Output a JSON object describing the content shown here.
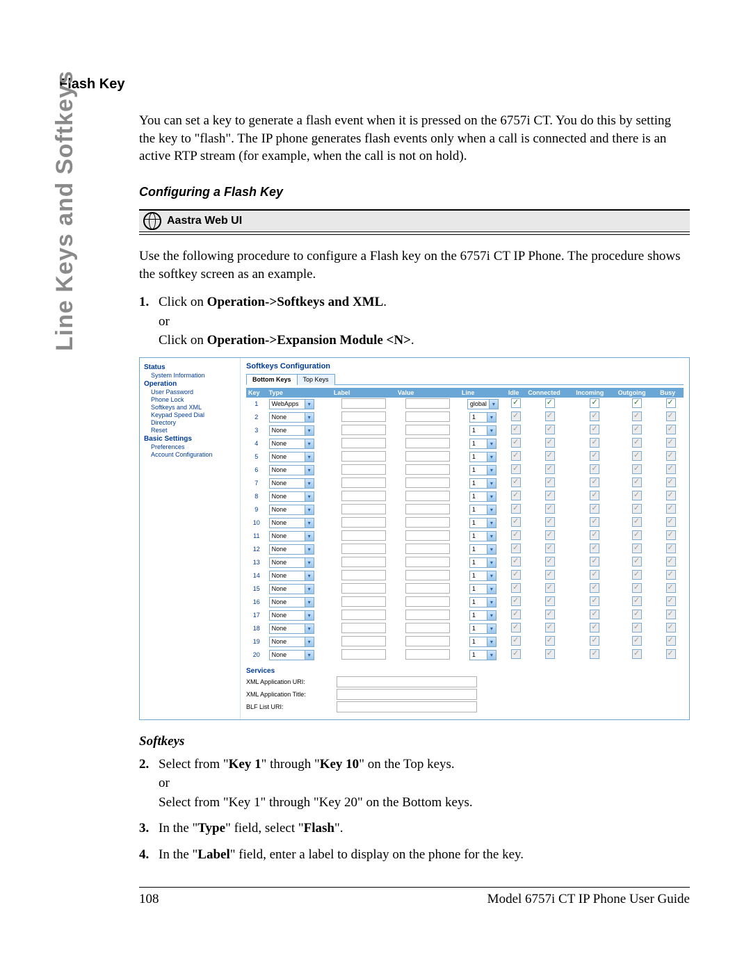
{
  "sidetab": "Line Keys and Softkeys",
  "heading": "Flash Key",
  "intro": "You can set a key to generate a flash event when it is pressed on the 6757i CT. You do this by setting the key to \"flash\". The IP phone generates flash events only when a call is connected and there is an active RTP stream (for example, when the call is not on hold).",
  "sub1": "Configuring a Flash Key",
  "banner": "Aastra Web UI",
  "para2": "Use the following procedure to configure a Flash key on the 6757i CT IP Phone. The procedure shows the softkey screen as an example.",
  "step1": {
    "pre": "Click on ",
    "b1": "Operation->Softkeys and XML",
    "post1": ".",
    "or": "or",
    "pre2": "Click on ",
    "b2": "Operation->Expansion Module <N>",
    "post2": "."
  },
  "softkeys_h": "Softkeys",
  "step2": {
    "a": "Select from \"",
    "b1": "Key 1",
    "mid": "\" through \"",
    "b2": "Key 10",
    "c": "\" on the Top keys.",
    "or": "or",
    "d": "Select from \"Key 1\" through \"Key 20\" on the Bottom keys."
  },
  "step3": {
    "a": "In the \"",
    "b1": "Type",
    "mid": "\" field, select \"",
    "b2": "Flash",
    "c": "\"."
  },
  "step4": {
    "a": "In the \"",
    "b1": "Label",
    "c": "\" field, enter a label to display on the phone for the key."
  },
  "footer": {
    "page": "108",
    "guide": "Model 6757i CT IP Phone User Guide"
  },
  "ui": {
    "title": "Softkeys Configuration",
    "tabs": {
      "bottom": "Bottom Keys",
      "top": "Top Keys"
    },
    "nav": {
      "status": "Status",
      "sysinfo": "System Information",
      "operation": "Operation",
      "userpw": "User Password",
      "phonelock": "Phone Lock",
      "softxml": "Softkeys and XML",
      "keypad": "Keypad Speed Dial",
      "directory": "Directory",
      "reset": "Reset",
      "basic": "Basic Settings",
      "prefs": "Preferences",
      "acct": "Account Configuration"
    },
    "cols": {
      "key": "Key",
      "type": "Type",
      "label": "Label",
      "value": "Value",
      "line": "Line",
      "idle": "Idle",
      "connected": "Connected",
      "incoming": "Incoming",
      "outgoing": "Outgoing",
      "busy": "Busy"
    },
    "rows": [
      {
        "key": "1",
        "type": "WebApps",
        "line": "global",
        "enabled": true
      },
      {
        "key": "2",
        "type": "None",
        "line": "1",
        "enabled": false
      },
      {
        "key": "3",
        "type": "None",
        "line": "1",
        "enabled": false
      },
      {
        "key": "4",
        "type": "None",
        "line": "1",
        "enabled": false
      },
      {
        "key": "5",
        "type": "None",
        "line": "1",
        "enabled": false
      },
      {
        "key": "6",
        "type": "None",
        "line": "1",
        "enabled": false
      },
      {
        "key": "7",
        "type": "None",
        "line": "1",
        "enabled": false
      },
      {
        "key": "8",
        "type": "None",
        "line": "1",
        "enabled": false
      },
      {
        "key": "9",
        "type": "None",
        "line": "1",
        "enabled": false
      },
      {
        "key": "10",
        "type": "None",
        "line": "1",
        "enabled": false
      },
      {
        "key": "11",
        "type": "None",
        "line": "1",
        "enabled": false
      },
      {
        "key": "12",
        "type": "None",
        "line": "1",
        "enabled": false
      },
      {
        "key": "13",
        "type": "None",
        "line": "1",
        "enabled": false
      },
      {
        "key": "14",
        "type": "None",
        "line": "1",
        "enabled": false
      },
      {
        "key": "15",
        "type": "None",
        "line": "1",
        "enabled": false
      },
      {
        "key": "16",
        "type": "None",
        "line": "1",
        "enabled": false
      },
      {
        "key": "17",
        "type": "None",
        "line": "1",
        "enabled": false
      },
      {
        "key": "18",
        "type": "None",
        "line": "1",
        "enabled": false
      },
      {
        "key": "19",
        "type": "None",
        "line": "1",
        "enabled": false
      },
      {
        "key": "20",
        "type": "None",
        "line": "1",
        "enabled": false
      }
    ],
    "services": {
      "title": "Services",
      "xmlapp": "XML Application URI:",
      "xmltitle": "XML Application Title:",
      "blf": "BLF List URI:"
    }
  }
}
